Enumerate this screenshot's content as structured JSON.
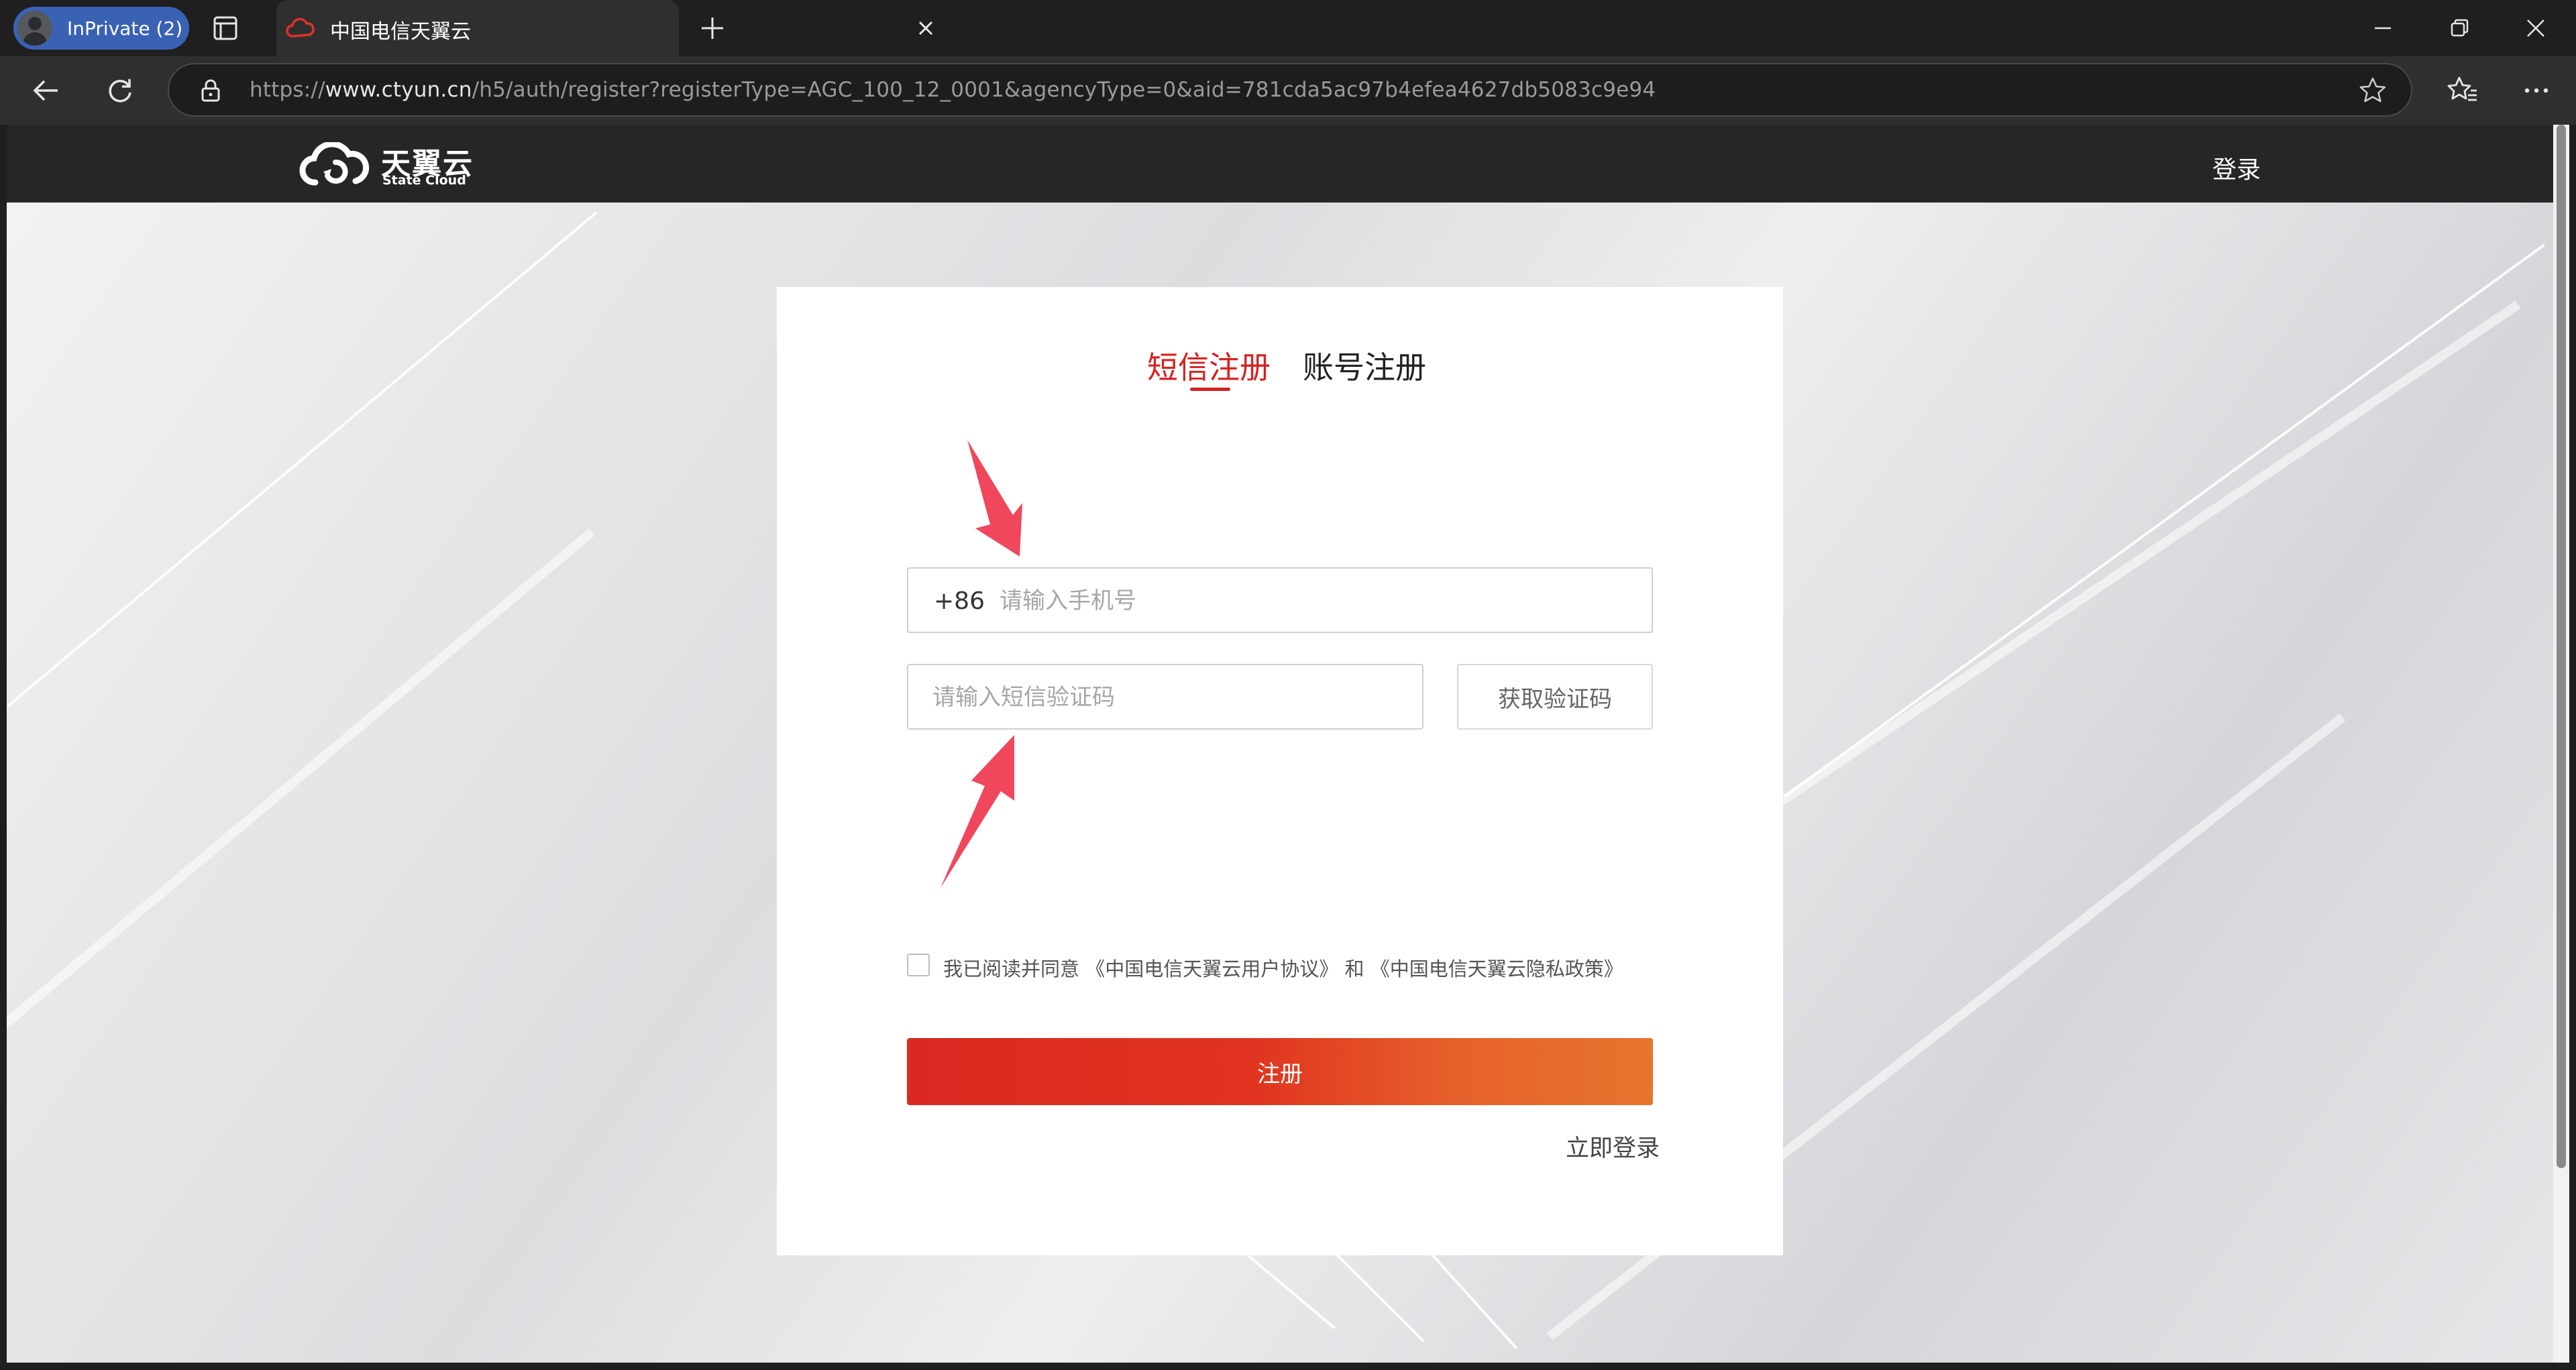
{
  "browser": {
    "profile_label": "InPrivate (2)",
    "tab_title": "中国电信天翼云",
    "url_prefix": "https://",
    "url_host": "www.ctyun.cn",
    "url_rest": "/h5/auth/register?registerType=AGC_100_12_0001&agencyType=0&aid=781cda5ac97b4efea4627db5083c9e94"
  },
  "header": {
    "logo_cn": "天翼云",
    "logo_en": "State Cloud",
    "login_link": "登录"
  },
  "form": {
    "tabs": [
      {
        "label": "短信注册",
        "active": true
      },
      {
        "label": "账号注册",
        "active": false
      }
    ],
    "country_code": "+86",
    "phone_placeholder": "请输入手机号",
    "sms_placeholder": "请输入短信验证码",
    "get_code_label": "获取验证码",
    "agreement": {
      "prefix": "我已阅读并同意",
      "user_agreement": "《中国电信天翼云用户协议》",
      "and": "和",
      "privacy_policy": "《中国电信天翼云隐私政策》",
      "checked": false
    },
    "submit_label": "注册",
    "login_now_label": "立即登录"
  },
  "colors": {
    "accent_red": "#d42222",
    "button_gradient_start": "#dc2821",
    "button_gradient_end": "#e7742d",
    "annotation_arrow": "#f0475c"
  }
}
